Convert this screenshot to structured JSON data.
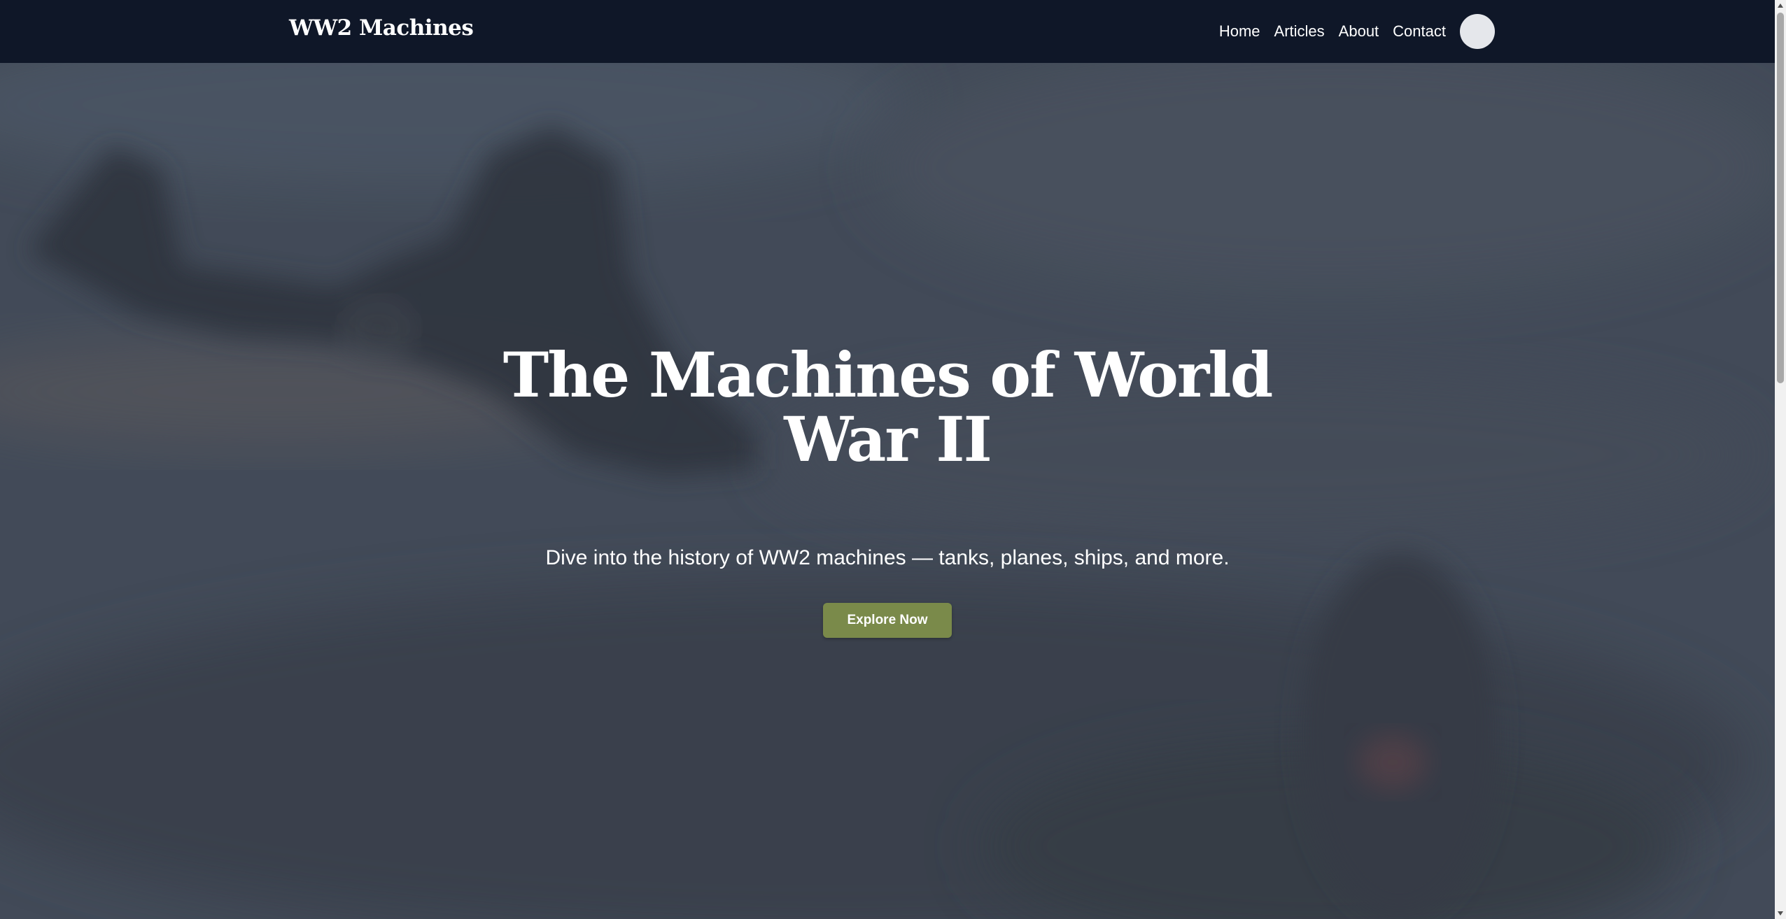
{
  "navbar": {
    "brand": "WW2 Machines",
    "links": [
      {
        "label": "Home"
      },
      {
        "label": "Articles"
      },
      {
        "label": "About"
      },
      {
        "label": "Contact"
      }
    ],
    "avatar": "user-avatar"
  },
  "hero": {
    "title": "The Machines of World War II",
    "subtitle": "Dive into the history of WW2 machines — tanks, planes, ships, and more.",
    "cta_label": "Explore Now",
    "background": "ww2 aircraft photo"
  },
  "colors": {
    "navbar_bg": "#0f1728",
    "cta_bg": "#7a8a4a",
    "text": "#ffffff"
  },
  "icons": {
    "scroll_up": "triangle-up-icon",
    "scroll_down": "triangle-down-icon"
  }
}
